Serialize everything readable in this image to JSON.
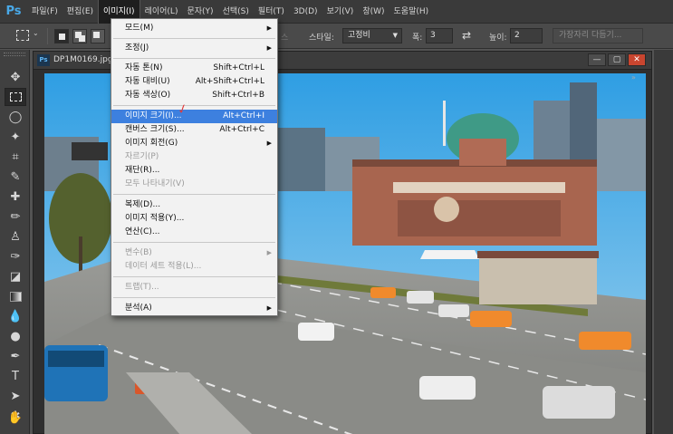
{
  "app": {
    "logo": "Ps"
  },
  "menubar": {
    "items": [
      "파일(F)",
      "편집(E)",
      "이미지(I)",
      "레이어(L)",
      "문자(Y)",
      "선택(S)",
      "필터(T)",
      "3D(D)",
      "보기(V)",
      "창(W)",
      "도움말(H)"
    ],
    "active": "이미지(I)"
  },
  "options": {
    "style_label": "스타일:",
    "style_value": "고정비",
    "width_label": "폭:",
    "width_value": "3",
    "height_label": "높이:",
    "height_value": "2",
    "refine_button": "가장자리 다듬기...",
    "hidden_label": "스"
  },
  "document": {
    "title": "DP1M0169.jpg",
    "ps_badge": "Ps"
  },
  "image_menu": {
    "items": [
      {
        "label": "모드(M)",
        "shortcut": "",
        "submenu": true,
        "disabled": false
      },
      {
        "label": "조정(J)",
        "shortcut": "",
        "submenu": true,
        "disabled": false
      },
      {
        "label": "자동 톤(N)",
        "shortcut": "Shift+Ctrl+L",
        "submenu": false,
        "disabled": false
      },
      {
        "label": "자동 대비(U)",
        "shortcut": "Alt+Shift+Ctrl+L",
        "submenu": false,
        "disabled": false
      },
      {
        "label": "자동 색상(O)",
        "shortcut": "Shift+Ctrl+B",
        "submenu": false,
        "disabled": false
      },
      {
        "label": "이미지 크기(I)...",
        "shortcut": "Alt+Ctrl+I",
        "submenu": false,
        "disabled": false,
        "highlighted": true
      },
      {
        "label": "캔버스 크기(S)...",
        "shortcut": "Alt+Ctrl+C",
        "submenu": false,
        "disabled": false
      },
      {
        "label": "이미지 회전(G)",
        "shortcut": "",
        "submenu": true,
        "disabled": false
      },
      {
        "label": "자르기(P)",
        "shortcut": "",
        "submenu": false,
        "disabled": true
      },
      {
        "label": "재단(R)...",
        "shortcut": "",
        "submenu": false,
        "disabled": false
      },
      {
        "label": "모두 나타내기(V)",
        "shortcut": "",
        "submenu": false,
        "disabled": true
      },
      {
        "label": "복제(D)...",
        "shortcut": "",
        "submenu": false,
        "disabled": false
      },
      {
        "label": "이미지 적용(Y)...",
        "shortcut": "",
        "submenu": false,
        "disabled": false
      },
      {
        "label": "연산(C)...",
        "shortcut": "",
        "submenu": false,
        "disabled": false
      },
      {
        "label": "변수(B)",
        "shortcut": "",
        "submenu": true,
        "disabled": true
      },
      {
        "label": "데이터 세트 적용(L)...",
        "shortcut": "",
        "submenu": false,
        "disabled": true
      },
      {
        "label": "트랩(T)...",
        "shortcut": "",
        "submenu": false,
        "disabled": true
      },
      {
        "label": "분석(A)",
        "shortcut": "",
        "submenu": true,
        "disabled": false
      }
    ]
  },
  "colors": {
    "menu_highlight": "#3d80df",
    "ps_blue": "#49a9e8",
    "annotation_red": "#e23b3b"
  }
}
